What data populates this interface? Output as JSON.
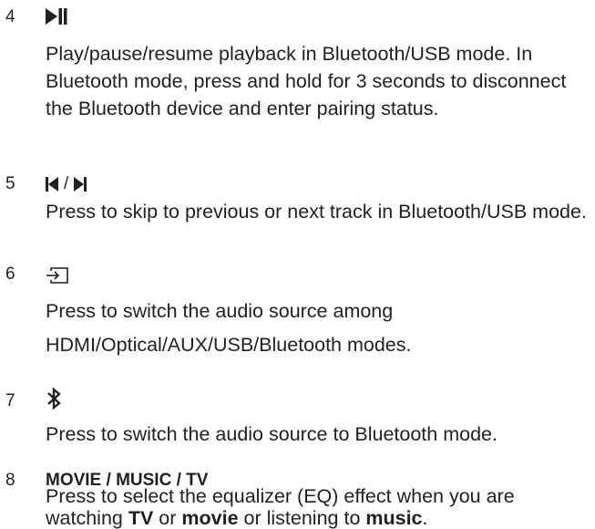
{
  "items": [
    {
      "number": "4",
      "icon": "play-pause-icon",
      "description": "Play/pause/resume playback in Bluetooth/USB mode. In Bluetooth mode, press and hold for 3 seconds to disconnect the Bluetooth device and enter pairing status."
    },
    {
      "number": "5",
      "icon": "previous-next-track-icon",
      "separator": "/",
      "description": "Press to skip to previous or next track in Bluetooth/USB mode."
    },
    {
      "number": "6",
      "icon": "source-input-icon",
      "description_lines": [
        "Press to switch the audio source among",
        "HDMI/Optical/AUX/USB/Bluetooth modes."
      ]
    },
    {
      "number": "7",
      "icon": "bluetooth-icon",
      "description": "Press to switch the audio source to Bluetooth mode."
    },
    {
      "number": "8",
      "title": "MOVIE / MUSIC / TV",
      "description_parts": {
        "line1": "Press to select the equalizer (EQ) effect when you are",
        "pre": "watching ",
        "tv": "TV",
        "mid1": " or ",
        "movie": "movie",
        "mid2": " or listening to ",
        "music": "music",
        "end": "."
      }
    }
  ],
  "text_color": "#231f20"
}
